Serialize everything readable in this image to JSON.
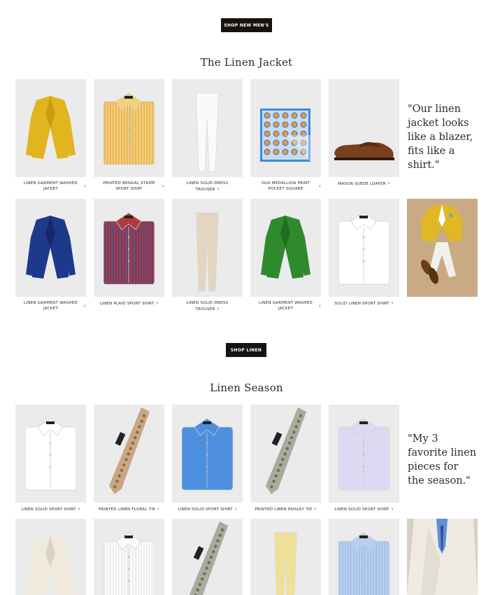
{
  "buttons": {
    "shop_new_mens": "SHOP NEW MEN'S",
    "shop_linen": "SHOP LINEN"
  },
  "section1": {
    "title": "The Linen Jacket",
    "quote": "\"Our linen jacket looks like a blazer, fits like a shirt.\"",
    "row1": [
      {
        "name": "LINEN GARMENT WASHED JACKET",
        "icon": "yellow-jacket-icon"
      },
      {
        "name": "PRINTED BENGAL STRIPE SPORT SHIRT",
        "icon": "striped-shirt-icon"
      },
      {
        "name": "LINEN SOLID DRESS TROUSER",
        "icon": "white-trouser-icon"
      },
      {
        "name": "SILK MEDALLION PRINT POCKET SQUARE",
        "icon": "pocket-square-icon"
      },
      {
        "name": "MASON SUEDE LOAFER",
        "icon": "loafer-icon"
      }
    ],
    "row2": [
      {
        "name": "LINEN GARMENT WASHED JACKET",
        "icon": "navy-jacket-icon"
      },
      {
        "name": "LINEN PLAID SPORT SHIRT",
        "icon": "plaid-shirt-icon"
      },
      {
        "name": "LINEN SOLID DRESS TROUSER",
        "icon": "tan-trouser-icon"
      },
      {
        "name": "LINEN GARMENT WASHED JACKET",
        "icon": "green-jacket-icon"
      },
      {
        "name": "SOLID LINEN SPORT SHIRT",
        "icon": "white-shirt-icon"
      }
    ]
  },
  "section2": {
    "title": "Linen Season",
    "quote": "\"My 3 favorite linen pieces for the season.\"",
    "row1": [
      {
        "name": "LINEN SOLID SPORT SHIRT",
        "icon": "white-shirt-icon"
      },
      {
        "name": "PRINTED LINEN FLORAL TIE",
        "icon": "floral-tie-icon"
      },
      {
        "name": "LINEN SOLID SPORT SHIRT",
        "icon": "blue-shirt-icon"
      },
      {
        "name": "PRINTED LINEN PAISLEY TIE",
        "icon": "paisley-tie-icon"
      },
      {
        "name": "LINEN SOLID SPORT SHIRT",
        "icon": "lavender-shirt-icon"
      }
    ],
    "row2": [
      {
        "name": "",
        "icon": "cream-jacket-icon"
      },
      {
        "name": "",
        "icon": "tuxedo-shirt-icon"
      },
      {
        "name": "",
        "icon": "paisley-tie-icon"
      },
      {
        "name": "",
        "icon": "yellow-trouser-icon"
      },
      {
        "name": "",
        "icon": "light-blue-shirt-icon"
      }
    ]
  },
  "colors": {
    "button_bg": "#16120f",
    "tile_bg": "#ebebeb"
  }
}
